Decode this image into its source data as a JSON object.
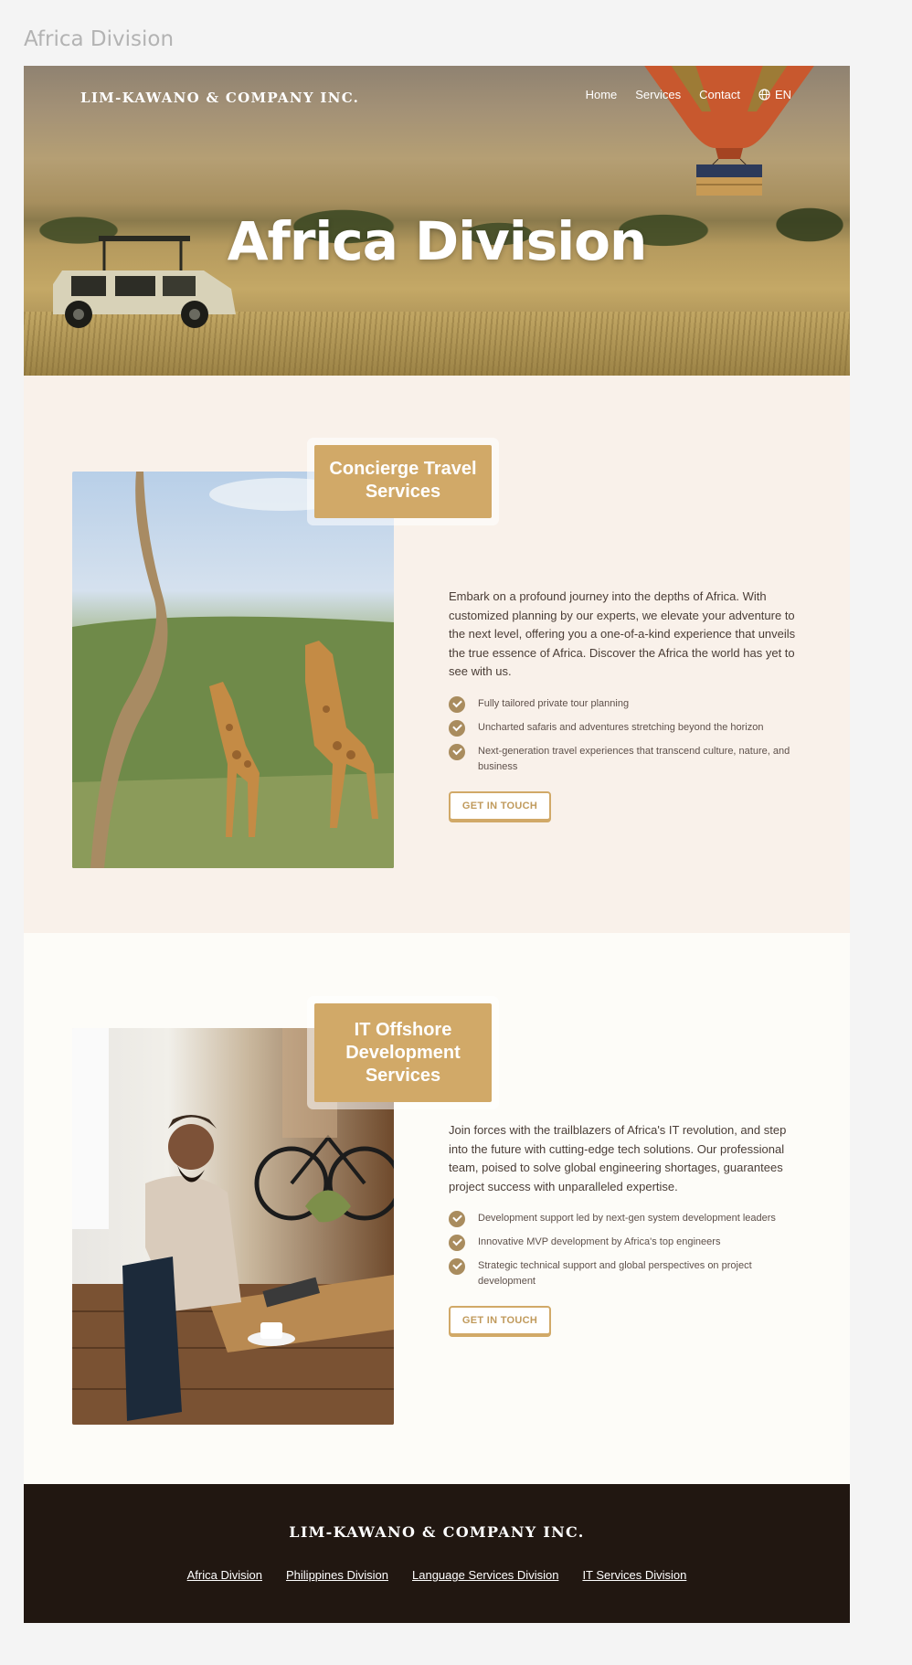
{
  "page_label": "Africa Division",
  "header": {
    "logo": "LIM-KAWANO & COMPANY INC.",
    "nav": [
      "Home",
      "Services",
      "Contact"
    ],
    "lang": "EN",
    "icons": {
      "lang": "globe-icon"
    }
  },
  "hero": {
    "title": "Africa Division"
  },
  "sections": [
    {
      "tag": "Concierge Travel Services",
      "lead": "Embark on a profound journey into the depths of Africa. With customized planning by our experts, we elevate your adventure to the next level, offering you a one-of-a-kind experience that unveils the true essence of Africa. Discover the Africa the world has yet to see with us.",
      "features": [
        "Fully tailored private tour planning",
        "Uncharted safaris and adventures stretching beyond the horizon",
        "Next-generation travel experiences that transcend culture, nature, and business"
      ],
      "button": "GET IN TOUCH"
    },
    {
      "tag": "IT Offshore Development Services",
      "lead": "Join forces with the trailblazers of Africa's IT revolution, and step into the future with cutting-edge tech solutions. Our professional team, poised to solve global engineering shortages, guarantees project success with unparalleled expertise.",
      "features": [
        "Development support led by next-gen system development leaders",
        "Innovative MVP development by Africa's top engineers",
        "Strategic technical support and global perspectives on project development"
      ],
      "button": "GET IN TOUCH"
    }
  ],
  "footer": {
    "logo": "LIM-KAWANO & COMPANY INC.",
    "links": [
      "Africa Division",
      "Philippines Division",
      "Language Services Division",
      "IT Services Division"
    ]
  },
  "colors": {
    "accent": "#d1a968",
    "footer_bg": "#211711",
    "section1_bg": "#f9f1ea",
    "section2_bg": "#fdfcf8"
  }
}
